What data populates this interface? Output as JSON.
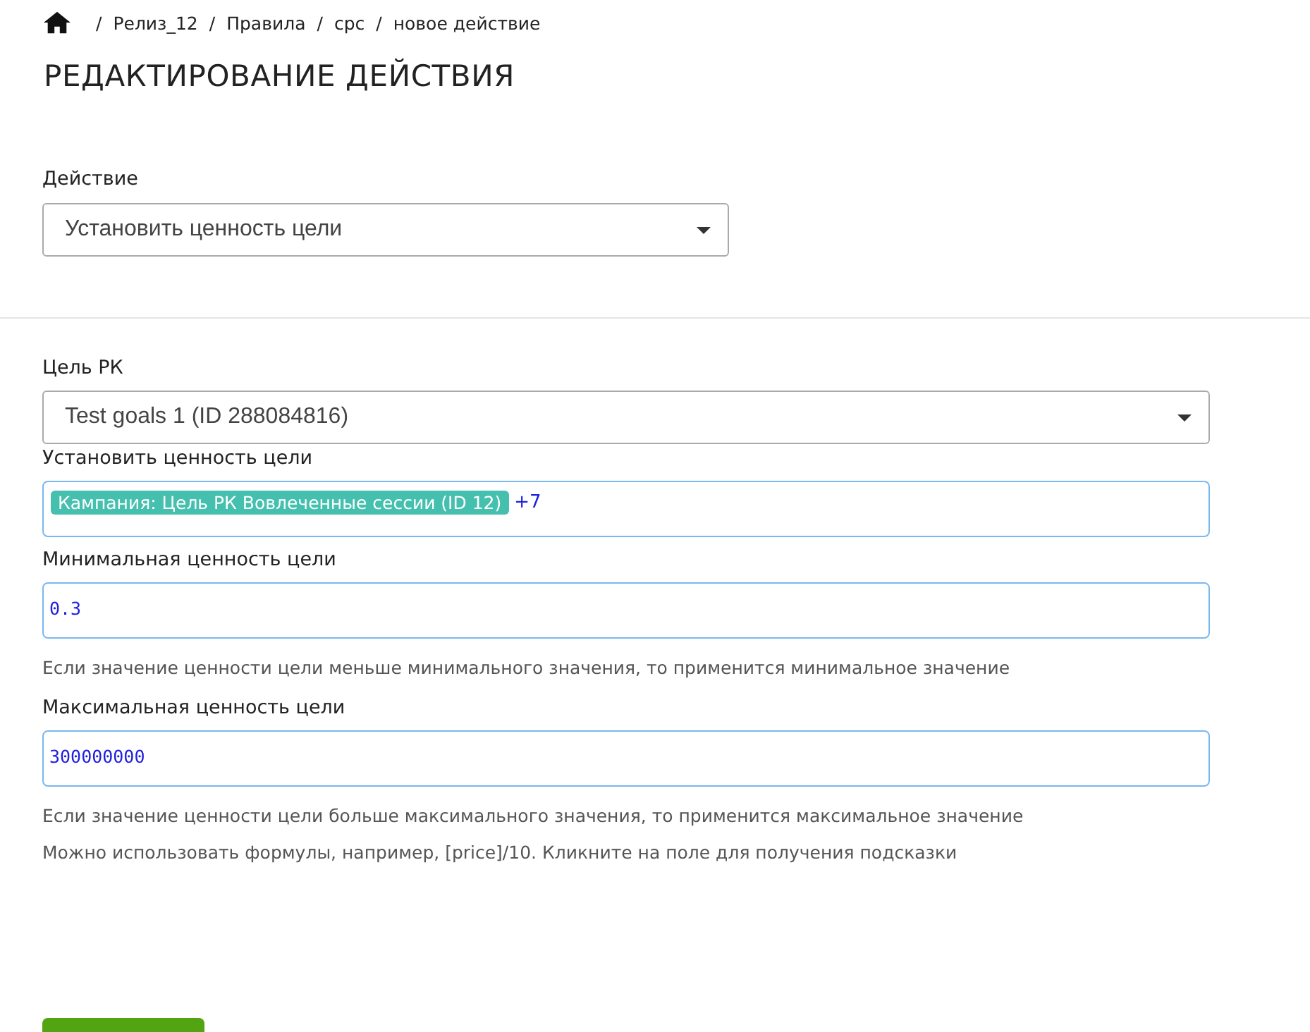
{
  "breadcrumbs": [
    {
      "separator": "/",
      "label": "Релиз_12"
    },
    {
      "separator": "/",
      "label": "Правила"
    },
    {
      "separator": "/",
      "label": "cpc"
    },
    {
      "separator": "/",
      "label": "новое действие"
    }
  ],
  "title": "РЕДАКТИРОВАНИЕ ДЕЙСТВИЯ",
  "action": {
    "label": "Действие",
    "value": "Установить ценность цели"
  },
  "fields": [
    {
      "kind": "select",
      "label": "Цель РК",
      "value": "Test goals 1 (ID 288084816)"
    },
    {
      "kind": "tags",
      "label": "Установить ценность цели",
      "tags": [
        "Кампания: Цель РК Вовлеченные сессии (ID 12)"
      ],
      "more": "+7"
    },
    {
      "kind": "input",
      "label": "Минимальная ценность цели",
      "value": "0.3",
      "hints": [
        "Если значение ценности цели меньше минимального значения, то применится минимальное значение"
      ]
    },
    {
      "kind": "input",
      "label": "Максимальная ценность цели",
      "value": "300000000",
      "hints": [
        "Если значение ценности цели больше максимального значения, то применится максимальное значение",
        "Можно использовать формулы, например, [price]/10. Кликните на поле для получения подсказки"
      ]
    }
  ]
}
